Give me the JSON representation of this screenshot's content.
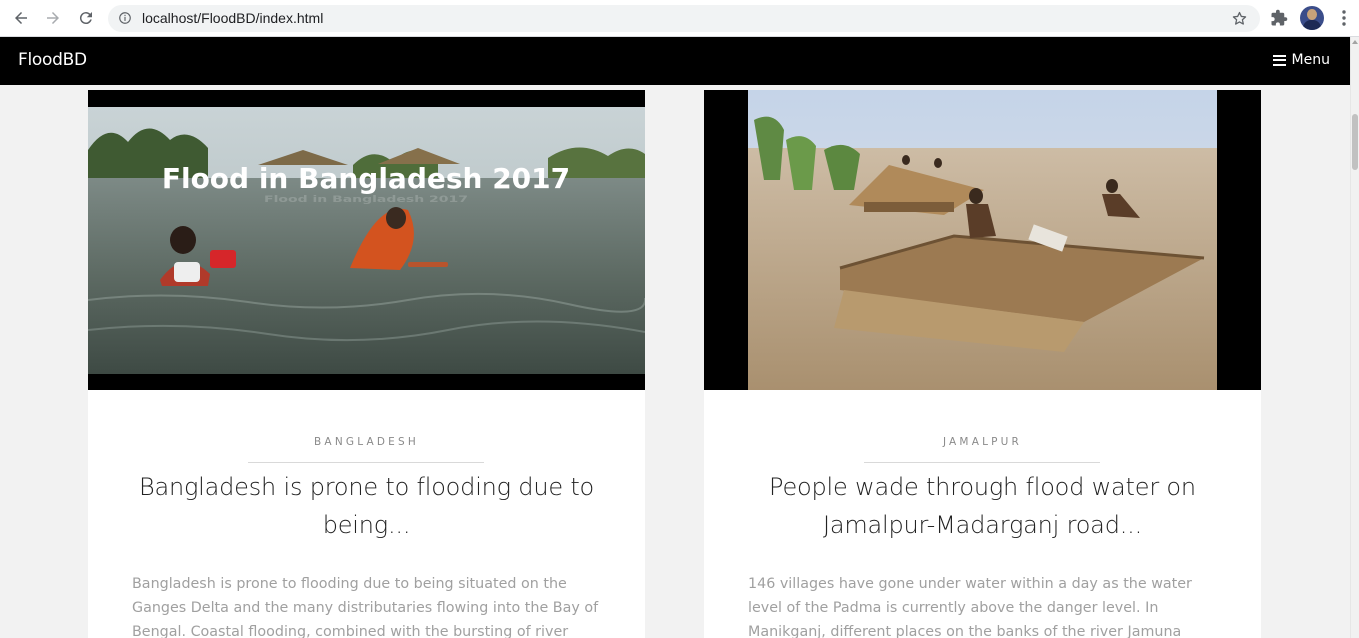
{
  "browser": {
    "url": "localhost/FloodBD/index.html",
    "icons": [
      "back-icon",
      "forward-icon",
      "reload-icon",
      "info-icon",
      "star-icon",
      "extensions-icon",
      "avatar",
      "kebab-menu-icon"
    ]
  },
  "navbar": {
    "brand": "FloodBD",
    "menu_label": "Menu"
  },
  "posts": [
    {
      "image_overlay": "Flood in Bangladesh 2017",
      "category": "BANGLADESH",
      "title": "Bangladesh is prone to flooding due to being...",
      "excerpt": "Bangladesh is prone to flooding due to being situated on the Ganges Delta and the many distributaries flowing into the Bay of Bengal. Coastal flooding, combined with the bursting of river"
    },
    {
      "category": "JAMALPUR",
      "title": "People wade through flood water on Jamalpur-Madarganj road...",
      "excerpt": "146 villages have gone under water within a day as the water level of the Padma is currently above the danger level. In Manikganj, different places on the banks of the river Jamuna"
    }
  ],
  "colors": {
    "navbar_bg": "#000000",
    "page_bg": "#f2f2f2",
    "card_bg": "#ffffff",
    "category_text": "#8a8a8a",
    "excerpt_text": "#a0a0a0"
  }
}
